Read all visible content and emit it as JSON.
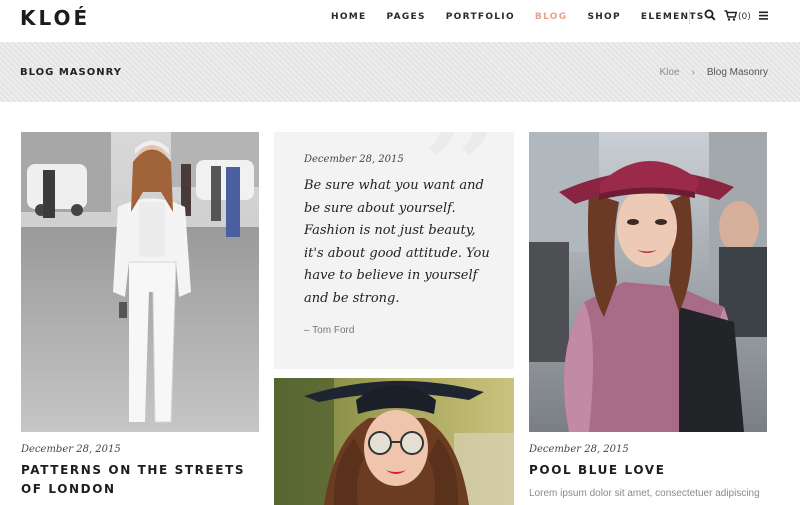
{
  "header": {
    "logo": "KLOÉ",
    "nav": [
      "HOME",
      "PAGES",
      "PORTFOLIO",
      "BLOG",
      "SHOP",
      "ELEMENTS"
    ],
    "active_nav": "BLOG",
    "cart_count": "(0)",
    "icons": [
      "search-icon",
      "cart-icon",
      "menu-icon"
    ],
    "accent_color": "#e8a08e"
  },
  "title_bar": {
    "title": "BLOG MASONRY",
    "breadcrumb": [
      "Kloe",
      "Blog Masonry"
    ],
    "separator": "›"
  },
  "posts": [
    {
      "date": "December 28, 2015",
      "title": "PATTERNS ON THE STREETS OF LONDON"
    },
    {
      "date": "December 28, 2015",
      "title": "POOL BLUE LOVE",
      "excerpt": "Lorem ipsum dolor sit amet, consectetuer adipiscing"
    }
  ],
  "quote": {
    "date": "December 28, 2015",
    "lines": [
      "Be sure what you want and",
      "be sure about yourself.",
      "Fashion is not just beauty,",
      "it's about good attitude. You",
      "have to believe in yourself",
      "and be strong."
    ],
    "author": "– Tom Ford"
  }
}
